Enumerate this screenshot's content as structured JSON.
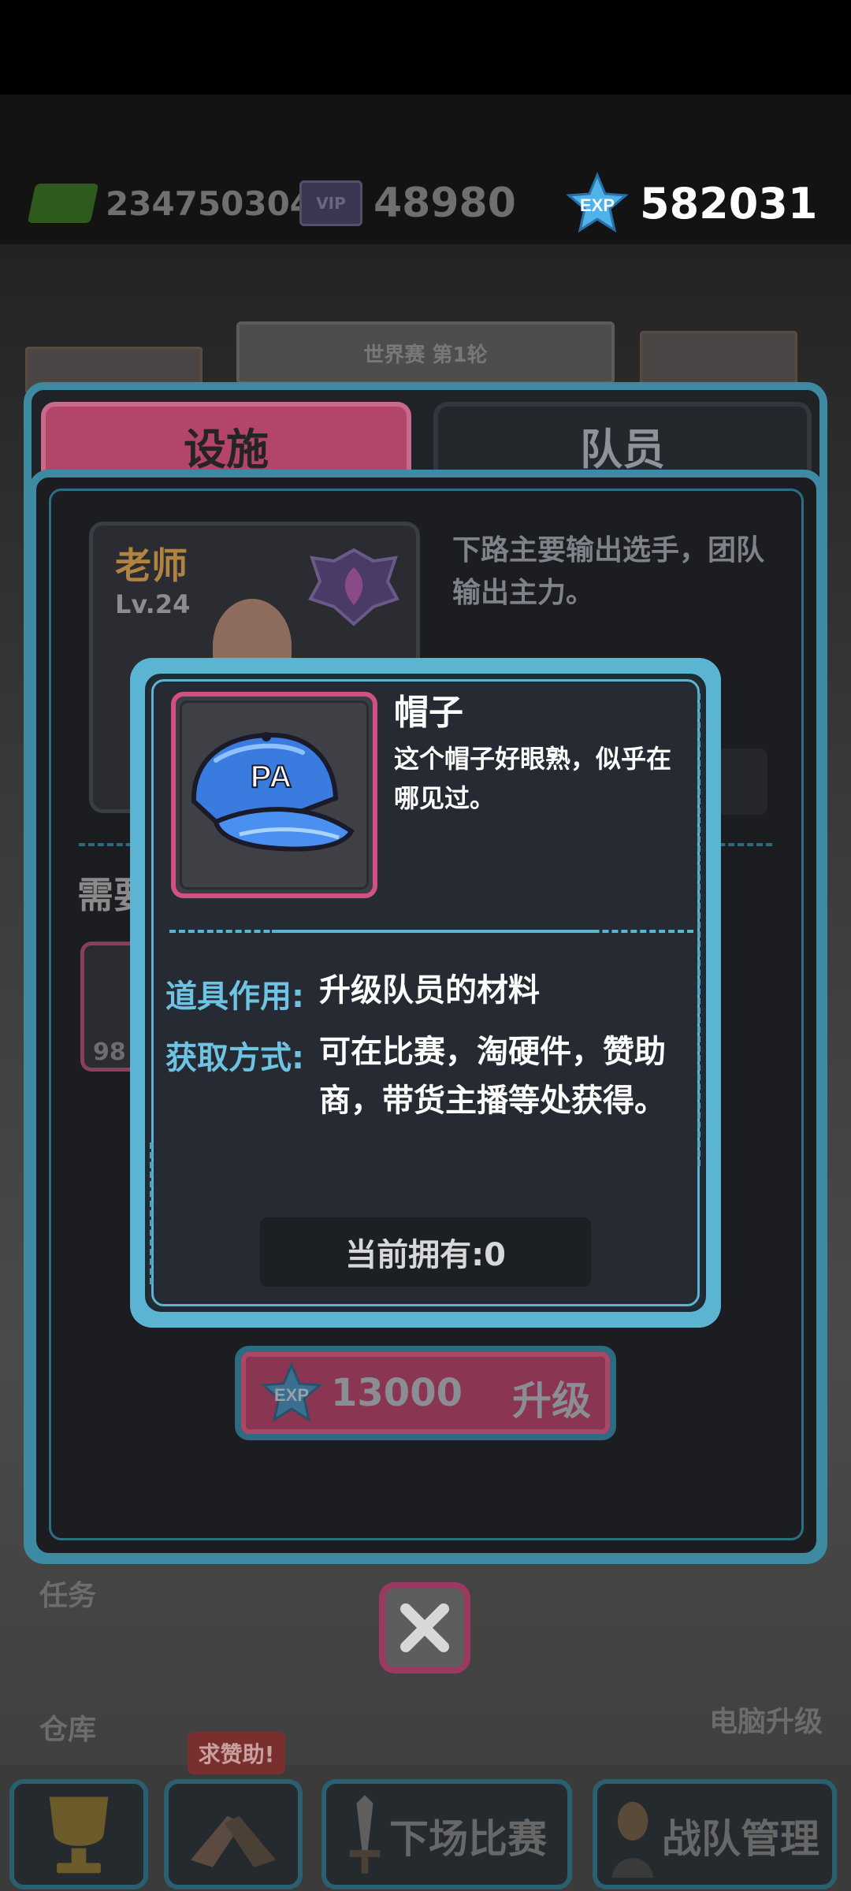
{
  "topbar": {
    "cash": "234750304",
    "vip_label": "VIP",
    "vip_points": "48980",
    "exp_icon_label": "EXP",
    "exp": "582031"
  },
  "scene": {
    "sign": "世界赛 第1轮"
  },
  "tabs": [
    {
      "label": "设施"
    },
    {
      "label": "队员"
    }
  ],
  "member": {
    "name": "老师",
    "level": "Lv.24",
    "description": "下路主要输出选手，团队输出主力。",
    "need_label": "需要",
    "need_count": "98"
  },
  "upgrade": {
    "exp_icon_label": "EXP",
    "cost": "13000",
    "label": "升级"
  },
  "dialog": {
    "item_name": "帽子",
    "item_flavor": "这个帽子好眼熟，似乎在哪见过。",
    "cap_text": "PA",
    "effect_label": "道具作用:",
    "effect_value": "升级队员的材料",
    "source_label": "获取方式:",
    "source_value": "可在比赛，淘硬件，赞助商，带货主播等处获得。",
    "owned": "当前拥有:0"
  },
  "side_buttons": {
    "tasks": "任务",
    "warehouse": "仓库",
    "pc_upgrade": "电脑升级"
  },
  "bottom_nav": {
    "help_tag": "求赞助!",
    "next_match": "下场比赛",
    "team_manage": "战队管理"
  },
  "colors": {
    "dialog_border": "#5ab4d2",
    "label_blue": "#6ec3e3",
    "item_frame": "#d34f85",
    "tab_active": "#b4456a"
  }
}
